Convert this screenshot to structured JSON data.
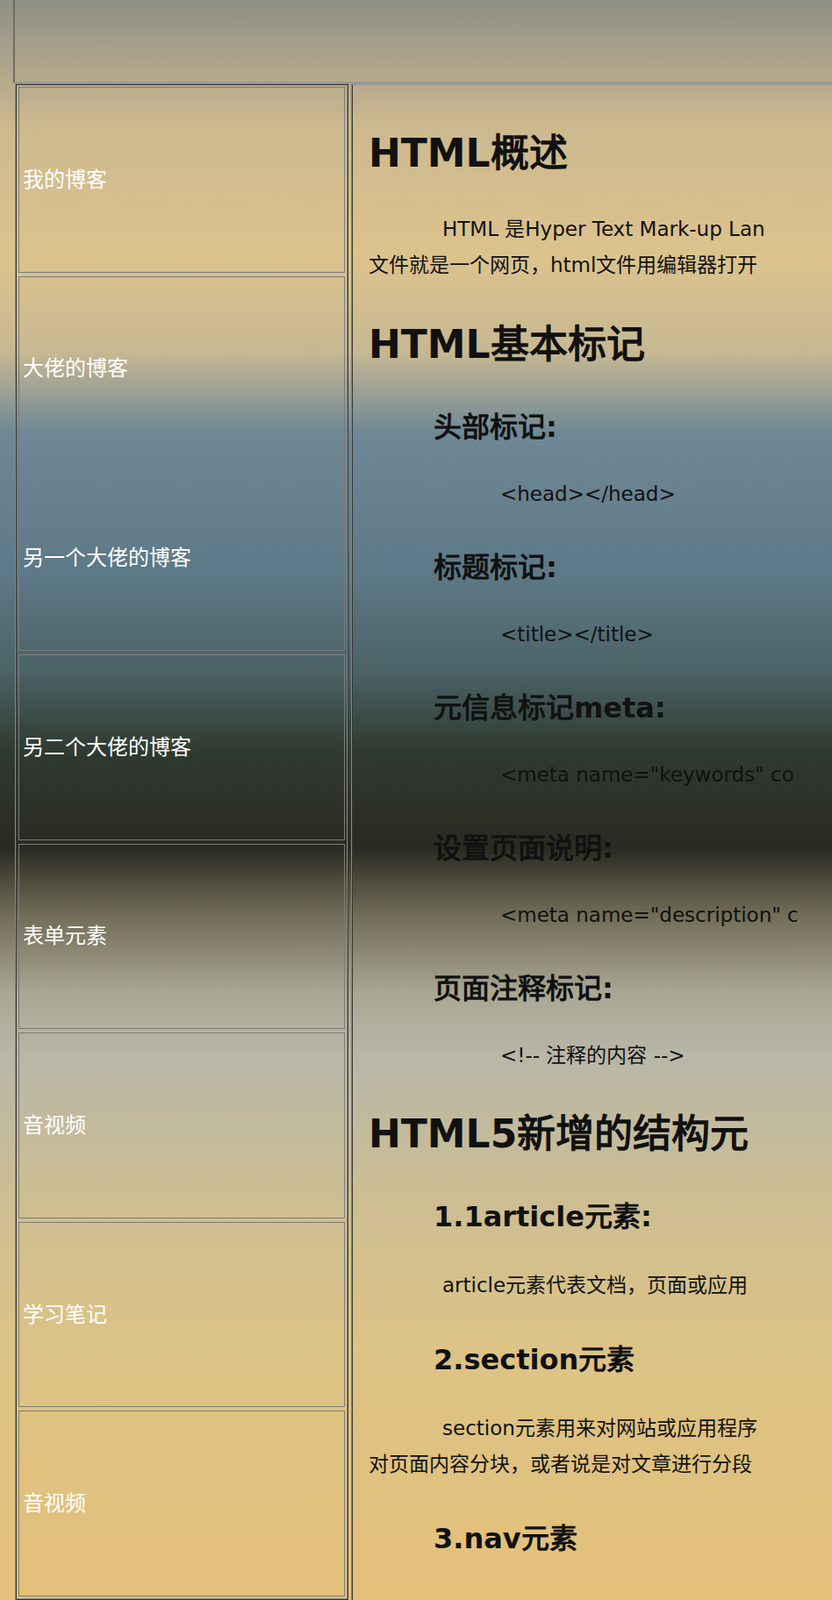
{
  "sidebar": {
    "items": [
      "我的博客",
      "大佬的博客",
      "另一个大佬的博客",
      "另二个大佬的博客",
      "表单元素",
      "音视频",
      "学习笔记",
      "音视频"
    ]
  },
  "content": {
    "blocks": [
      {
        "kind": "h1",
        "text": "HTML概述"
      },
      {
        "kind": "para",
        "lines": [
          "HTML 是Hyper Text Mark-up Lan",
          "文件就是一个网页，html文件用编辑器打开"
        ]
      },
      {
        "kind": "h1",
        "text": "HTML基本标记"
      },
      {
        "kind": "h2",
        "text": "头部标记:"
      },
      {
        "kind": "code",
        "text": "<head></head>"
      },
      {
        "kind": "h2",
        "text": "标题标记:"
      },
      {
        "kind": "code",
        "text": "<title></title>"
      },
      {
        "kind": "h2",
        "text": "元信息标记meta:"
      },
      {
        "kind": "code",
        "text": "<meta name=\"keywords\" co"
      },
      {
        "kind": "h2",
        "text": "设置页面说明:"
      },
      {
        "kind": "code",
        "text": "<meta name=\"description\" c"
      },
      {
        "kind": "h2",
        "text": "页面注释标记:"
      },
      {
        "kind": "code",
        "text": "<!-- 注释的内容 -->"
      },
      {
        "kind": "h1",
        "text": "HTML5新增的结构元"
      },
      {
        "kind": "h2",
        "text": "1.1article元素:"
      },
      {
        "kind": "para",
        "lines": [
          "article元素代表文档，页面或应用"
        ]
      },
      {
        "kind": "h2",
        "text": "2.section元素"
      },
      {
        "kind": "para",
        "lines": [
          "section元素用来对网站或应用程序",
          "对页面内容分块，或者说是对文章进行分段"
        ]
      },
      {
        "kind": "h2",
        "text": "3.nav元素"
      }
    ]
  }
}
